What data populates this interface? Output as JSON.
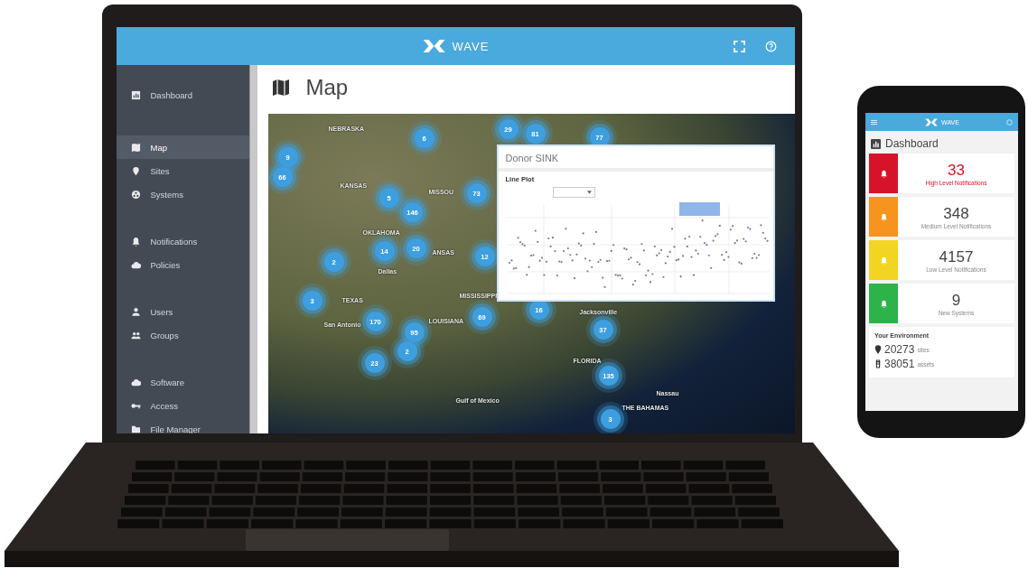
{
  "header": {
    "brand": "WAVE"
  },
  "sidebar": {
    "groups": [
      [
        {
          "label": "Dashboard",
          "selected": false
        }
      ],
      [
        {
          "label": "Map",
          "selected": true
        },
        {
          "label": "Sites",
          "selected": false
        },
        {
          "label": "Systems",
          "selected": false
        }
      ],
      [
        {
          "label": "Notifications",
          "selected": false
        },
        {
          "label": "Policies",
          "selected": false
        }
      ],
      [
        {
          "label": "Users",
          "selected": false
        },
        {
          "label": "Groups",
          "selected": false
        }
      ],
      [
        {
          "label": "Software",
          "selected": false
        },
        {
          "label": "Access",
          "selected": false
        },
        {
          "label": "File Manager",
          "selected": false
        }
      ]
    ]
  },
  "page": {
    "title": "Map"
  },
  "map": {
    "clusters": [
      "6",
      "29",
      "81",
      "77",
      "9",
      "66",
      "5",
      "73",
      "146",
      "14",
      "20",
      "12",
      "2",
      "3",
      "170",
      "95",
      "2",
      "23",
      "69",
      "16",
      "37",
      "135",
      "3"
    ],
    "labels": [
      "NEBRASKA",
      "KANSAS",
      "MISSOU",
      "OKLAHOMA",
      "ANSAS",
      "Dallas",
      "TEXAS",
      "San Antonio",
      "LOUISIANA",
      "MISSISSIPPI",
      "Gulf of Mexico",
      "Jacksonville",
      "FLORIDA",
      "Nassau",
      "THE BAHAMAS"
    ],
    "popup": {
      "title": "Donor SINK",
      "section": "Line Plot"
    }
  },
  "phone": {
    "brand": "WAVE",
    "title": "Dashboard",
    "cards": [
      {
        "value": "33",
        "label": "High Level Notifications",
        "color": "#d7132a",
        "emphasized": true
      },
      {
        "value": "348",
        "label": "Medium Level Notifications",
        "color": "#f7941d",
        "emphasized": false
      },
      {
        "value": "4157",
        "label": "Low Level Notifications",
        "color": "#f2d523",
        "emphasized": false
      },
      {
        "value": "9",
        "label": "New Systems",
        "color": "#2db34a",
        "emphasized": false
      }
    ],
    "environment": {
      "title": "Your Environment",
      "stats": [
        {
          "value": "20273",
          "unit": "sites"
        },
        {
          "value": "38051",
          "unit": "assets"
        }
      ]
    }
  }
}
